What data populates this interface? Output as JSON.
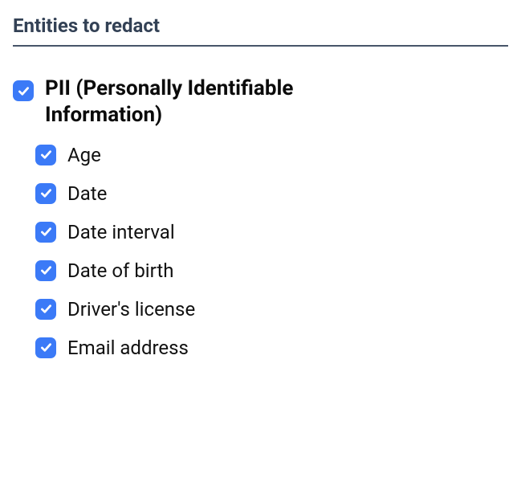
{
  "section_title": "Entities to redact",
  "group": {
    "label": "PII (Personally Identifiable Information)",
    "items": [
      {
        "label": "Age"
      },
      {
        "label": "Date"
      },
      {
        "label": "Date interval"
      },
      {
        "label": "Date of birth"
      },
      {
        "label": "Driver's license"
      },
      {
        "label": "Email address"
      }
    ]
  }
}
